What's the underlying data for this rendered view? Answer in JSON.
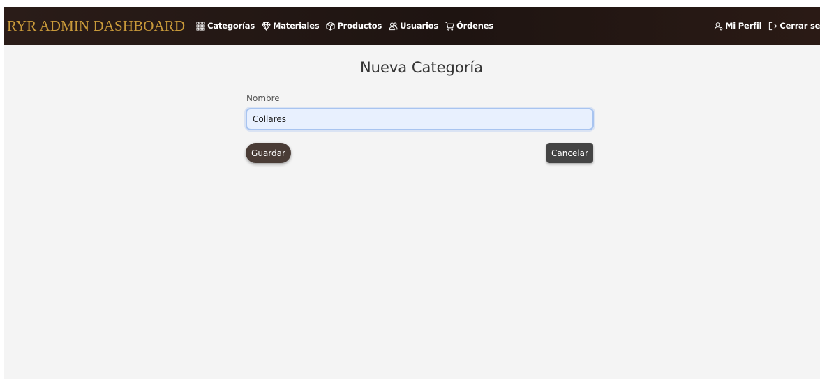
{
  "navbar": {
    "brand": "RYR ADMIN DASHBOARD",
    "links": [
      {
        "label": "Categorías",
        "icon": "grid-icon"
      },
      {
        "label": "Materiales",
        "icon": "gem-icon"
      },
      {
        "label": "Productos",
        "icon": "box-icon"
      },
      {
        "label": "Usuarios",
        "icon": "users-icon"
      },
      {
        "label": "Órdenes",
        "icon": "cart-icon"
      }
    ],
    "right_links": [
      {
        "label": "Mi Perfil",
        "icon": "user-icon"
      },
      {
        "label": "Cerrar sesió",
        "icon": "logout-icon"
      }
    ]
  },
  "form": {
    "title": "Nueva Categoría",
    "name_label": "Nombre",
    "name_value": "Collares",
    "save_label": "Guardar",
    "cancel_label": "Cancelar"
  },
  "colors": {
    "navbar_bg": "#241815",
    "brand": "#c99a3a",
    "page_bg": "#f4f4f4",
    "save_button": "#4a3c36",
    "cancel_button": "#444444",
    "input_bg": "#e8f0fe",
    "input_border": "#a8c4f0"
  }
}
